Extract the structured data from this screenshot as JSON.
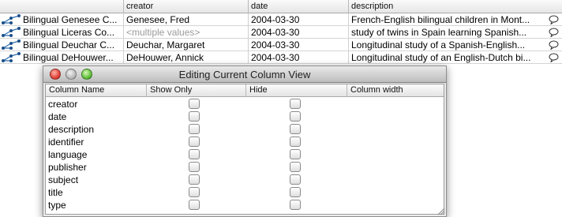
{
  "background_table": {
    "headers": [
      "",
      "creator",
      "date",
      "description"
    ],
    "rows": [
      {
        "title": "Bilingual Genesee C...",
        "creator": "Genesee, Fred",
        "creator_muted": false,
        "date": "2004-03-30",
        "description": "French-English bilingual children in Mont..."
      },
      {
        "title": "Bilingual Liceras Co...",
        "creator": "<multiple values>",
        "creator_muted": true,
        "date": "2004-03-30",
        "description": "study of twins in Spain learning Spanish..."
      },
      {
        "title": "Bilingual Deuchar C...",
        "creator": "Deuchar, Margaret",
        "creator_muted": false,
        "date": "2004-03-30",
        "description": "Longitudinal study of a Spanish-English..."
      },
      {
        "title": "Bilingual DeHouwer...",
        "creator": "DeHouwer, Annick",
        "creator_muted": false,
        "date": "2004-03-30",
        "description": "Longitudinal study of an English-Dutch bi..."
      }
    ]
  },
  "dialog": {
    "title": "Editing Current Column View",
    "columns": [
      "Column Name",
      "Show Only",
      "Hide",
      "Column width"
    ],
    "rows": [
      {
        "name": "creator",
        "show_only": false,
        "hide": false
      },
      {
        "name": "date",
        "show_only": false,
        "hide": false
      },
      {
        "name": "description",
        "show_only": false,
        "hide": false
      },
      {
        "name": "identifier",
        "show_only": false,
        "hide": false
      },
      {
        "name": "language",
        "show_only": false,
        "hide": false
      },
      {
        "name": "publisher",
        "show_only": false,
        "hide": false
      },
      {
        "name": "subject",
        "show_only": false,
        "hide": false
      },
      {
        "name": "title",
        "show_only": false,
        "hide": false
      },
      {
        "name": "type",
        "show_only": false,
        "hide": false
      }
    ]
  },
  "colors": {
    "close": "#e0443a",
    "minimize": "#bdbdbd",
    "zoom": "#62c13d",
    "muted_text": "#9a9a9a"
  },
  "icons": {
    "row_icon": "corpus-tree-icon",
    "comment_icon": "speech-bubble-icon"
  }
}
